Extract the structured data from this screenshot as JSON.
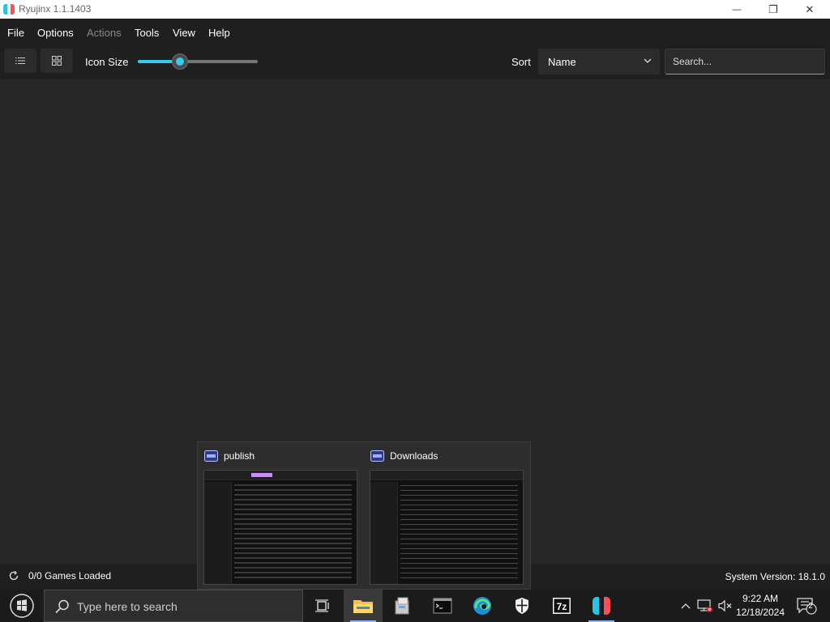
{
  "window": {
    "title": "Ryujinx 1.1.1403",
    "controls": {
      "minimize": "—",
      "restore": "❐",
      "close": "✕"
    }
  },
  "menu": {
    "items": [
      {
        "label": "File",
        "enabled": true
      },
      {
        "label": "Options",
        "enabled": true
      },
      {
        "label": "Actions",
        "enabled": false
      },
      {
        "label": "Tools",
        "enabled": true
      },
      {
        "label": "View",
        "enabled": true
      },
      {
        "label": "Help",
        "enabled": true
      }
    ]
  },
  "toolbar": {
    "list_view_icon": "list-icon",
    "grid_view_icon": "grid-icon",
    "icon_size_label": "Icon Size",
    "icon_size_slider_fraction": 0.35,
    "sort_label": "Sort",
    "sort_value": "Name",
    "search_placeholder": "Search..."
  },
  "status": {
    "games_loaded": "0/0 Games Loaded",
    "system_version": "System Version: 18.1.0"
  },
  "taskbar_preview": {
    "windows": [
      {
        "label": "publish"
      },
      {
        "label": "Downloads"
      }
    ]
  },
  "taskbar": {
    "search_placeholder": "Type here to search",
    "pinned": [
      {
        "name": "task-view-icon",
        "active": false
      },
      {
        "name": "file-explorer-icon",
        "active": true
      },
      {
        "name": "installer-icon",
        "active": false
      },
      {
        "name": "terminal-icon",
        "active": false
      },
      {
        "name": "edge-icon",
        "active": false
      },
      {
        "name": "security-shield-icon",
        "active": false
      },
      {
        "name": "7zip-icon",
        "active": false
      },
      {
        "name": "ryujinx-icon",
        "active": false
      }
    ],
    "time": "9:22 AM",
    "date": "12/18/2024",
    "notification_count": "2"
  },
  "colors": {
    "accent": "#38c9ef",
    "background": "#272727",
    "bar": "#1f1f1f",
    "taskbar": "#1b1b1b"
  }
}
